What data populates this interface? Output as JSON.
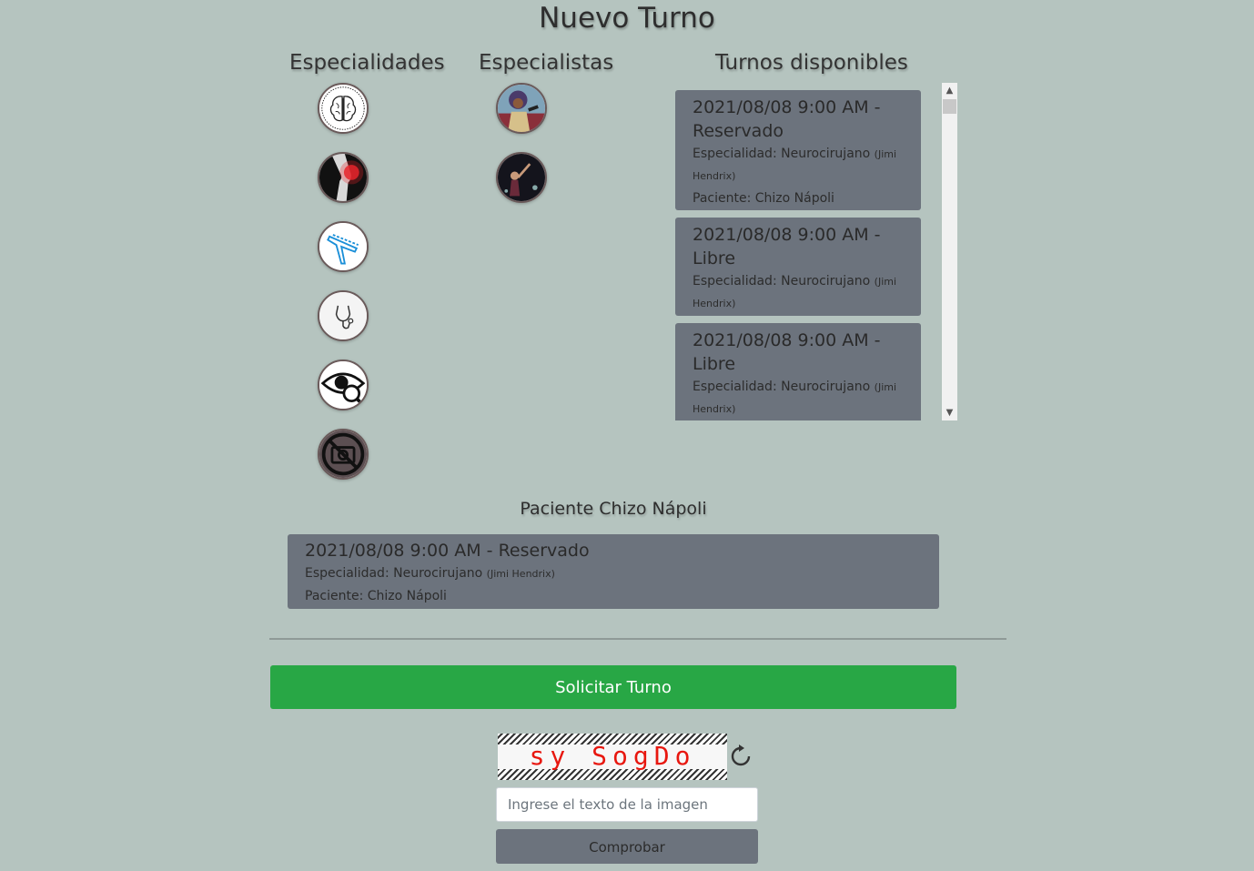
{
  "page": {
    "title": "Nuevo Turno"
  },
  "columns": {
    "especialidades": "Especialidades",
    "especialistas": "Especialistas",
    "turnos": "Turnos disponibles"
  },
  "especialidades": [
    {
      "icon": "brain-icon"
    },
    {
      "icon": "knee-xray-icon"
    },
    {
      "icon": "dental-tool-icon"
    },
    {
      "icon": "stethoscope-icon"
    },
    {
      "icon": "eye-magnifier-icon"
    },
    {
      "icon": "no-photo-icon"
    }
  ],
  "especialistas": [
    {
      "icon": "specialist-photo-1"
    },
    {
      "icon": "specialist-photo-2"
    }
  ],
  "turnos": [
    {
      "date": "2021/08/08 9:00 AM -",
      "status": "Reservado",
      "especialidad_label": "Especialidad:",
      "especialidad": "Neurocirujano",
      "doctor_1": "(Jimi",
      "doctor_2": "Hendrix)",
      "paciente_label": "Paciente:",
      "paciente": "Chizo Nápoli"
    },
    {
      "date": "2021/08/08 9:00 AM -",
      "status": "Libre",
      "especialidad_label": "Especialidad:",
      "especialidad": "Neurocirujano",
      "doctor_1": "(Jimi",
      "doctor_2": "Hendrix)"
    },
    {
      "date": "2021/08/08 9:00 AM -",
      "status": "Libre",
      "especialidad_label": "Especialidad:",
      "especialidad": "Neurocirujano",
      "doctor_1": "(Jimi",
      "doctor_2": "Hendrix)"
    }
  ],
  "paciente_section": {
    "title": "Paciente Chizo Nápoli",
    "card": {
      "date": "2021/08/08 9:00 AM - Reservado",
      "especialidad_label": "Especialidad:",
      "especialidad": "Neurocirujano",
      "doctor": "(Jimi Hendrix)",
      "paciente_label": "Paciente:",
      "paciente": "Chizo Nápoli"
    }
  },
  "actions": {
    "solicitar": "Solicitar Turno",
    "captcha_text": "sy SogDo",
    "captcha_placeholder": "Ingrese el texto de la imagen",
    "comprobar": "Comprobar"
  },
  "colors": {
    "background": "#b5c4bf",
    "card": "#6c737d",
    "primary_button": "#28a745",
    "captcha_text": "#e8170f"
  }
}
